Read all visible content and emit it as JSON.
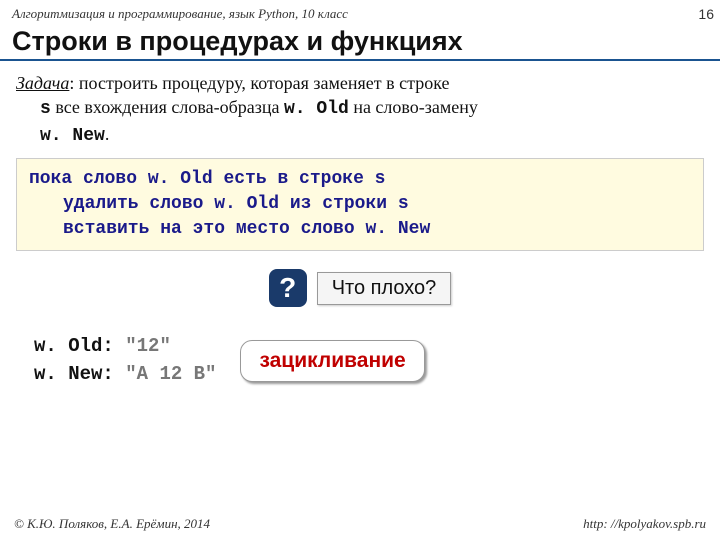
{
  "header": {
    "course": "Алгоритмизация и программирование, язык Python, 10 класс",
    "page_number": "16",
    "title": "Строки в процедурах и функциях"
  },
  "task": {
    "label": "Задача",
    "text_a": ": построить процедуру, которая заменяет в строке",
    "text_b": " все вхождения слова-образца ",
    "var_s": "s",
    "var_old": "w. Old",
    "text_c": " на слово-замену",
    "var_new": "w. New",
    "text_d": "."
  },
  "pseudocode": {
    "kw_while": "пока",
    "line1_rest": " слово w. Old есть в строке s",
    "line2": "удалить слово w. Old из строки s",
    "line3": "вставить на это место слово w. New"
  },
  "prompt": {
    "q": "?",
    "text": "Что плохо?"
  },
  "example": {
    "old_label": "w. Old:",
    "old_value": "\"12\"",
    "new_label": "w. New:",
    "new_value": "\"A 12 B\""
  },
  "warning": {
    "text": "зацикливание"
  },
  "footer": {
    "copyright": "© К.Ю. Поляков, Е.А. Ерёмин, 2014",
    "url": "http: //kpolyakov.spb.ru"
  }
}
